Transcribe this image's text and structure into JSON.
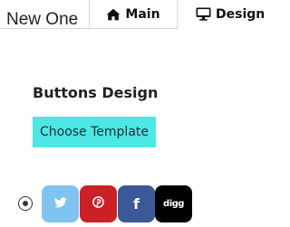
{
  "header": {
    "title": "New One",
    "tabs": [
      {
        "label": "Main",
        "icon": "home-icon"
      },
      {
        "label": "Design",
        "icon": "desktop-icon"
      }
    ]
  },
  "main": {
    "heading": "Buttons Design",
    "choose_button": "Choose Template",
    "social_buttons": [
      {
        "network": "twitter",
        "icon": "twitter-icon",
        "color": "#7fc3f0"
      },
      {
        "network": "pinterest",
        "icon": "pinterest-icon",
        "color": "#cc2027"
      },
      {
        "network": "facebook",
        "icon": "facebook-icon",
        "glyph": "f",
        "color": "#3b5998"
      },
      {
        "network": "digg",
        "icon": "digg-icon",
        "glyph": "digg",
        "color": "#000000"
      }
    ]
  },
  "colors": {
    "accent": "#4de8e4"
  }
}
